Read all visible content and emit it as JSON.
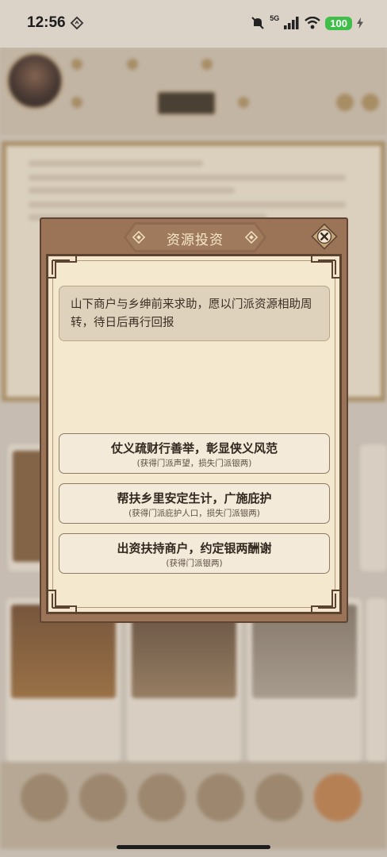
{
  "status_bar": {
    "time": "12:56",
    "network": "5G",
    "battery": "100",
    "icons": [
      "navigation-icon",
      "mute-icon",
      "signal-icon",
      "wifi-icon",
      "battery-icon",
      "charging-icon"
    ]
  },
  "modal": {
    "title": "资源投资",
    "description": "山下商户与乡绅前来求助，愿以门派资源相助周转，待日后再行回报",
    "options": [
      {
        "label": "仗义疏财行善举，彰显侠义风范",
        "effect": "(获得门派声望，损失门派银两)"
      },
      {
        "label": "帮扶乡里安定生计，广施庇护",
        "effect": "(获得门派庇护人口，损失门派银两)"
      },
      {
        "label": "出资扶持商户，约定银两酬谢",
        "effect": "(获得门派银两)"
      }
    ]
  },
  "colors": {
    "modal_frame": "#9b7357",
    "modal_paper": "#f4e8cf",
    "title_text": "#f7e9c8",
    "option_bg": "#f3ead9",
    "battery_green": "#3fbf4a"
  }
}
